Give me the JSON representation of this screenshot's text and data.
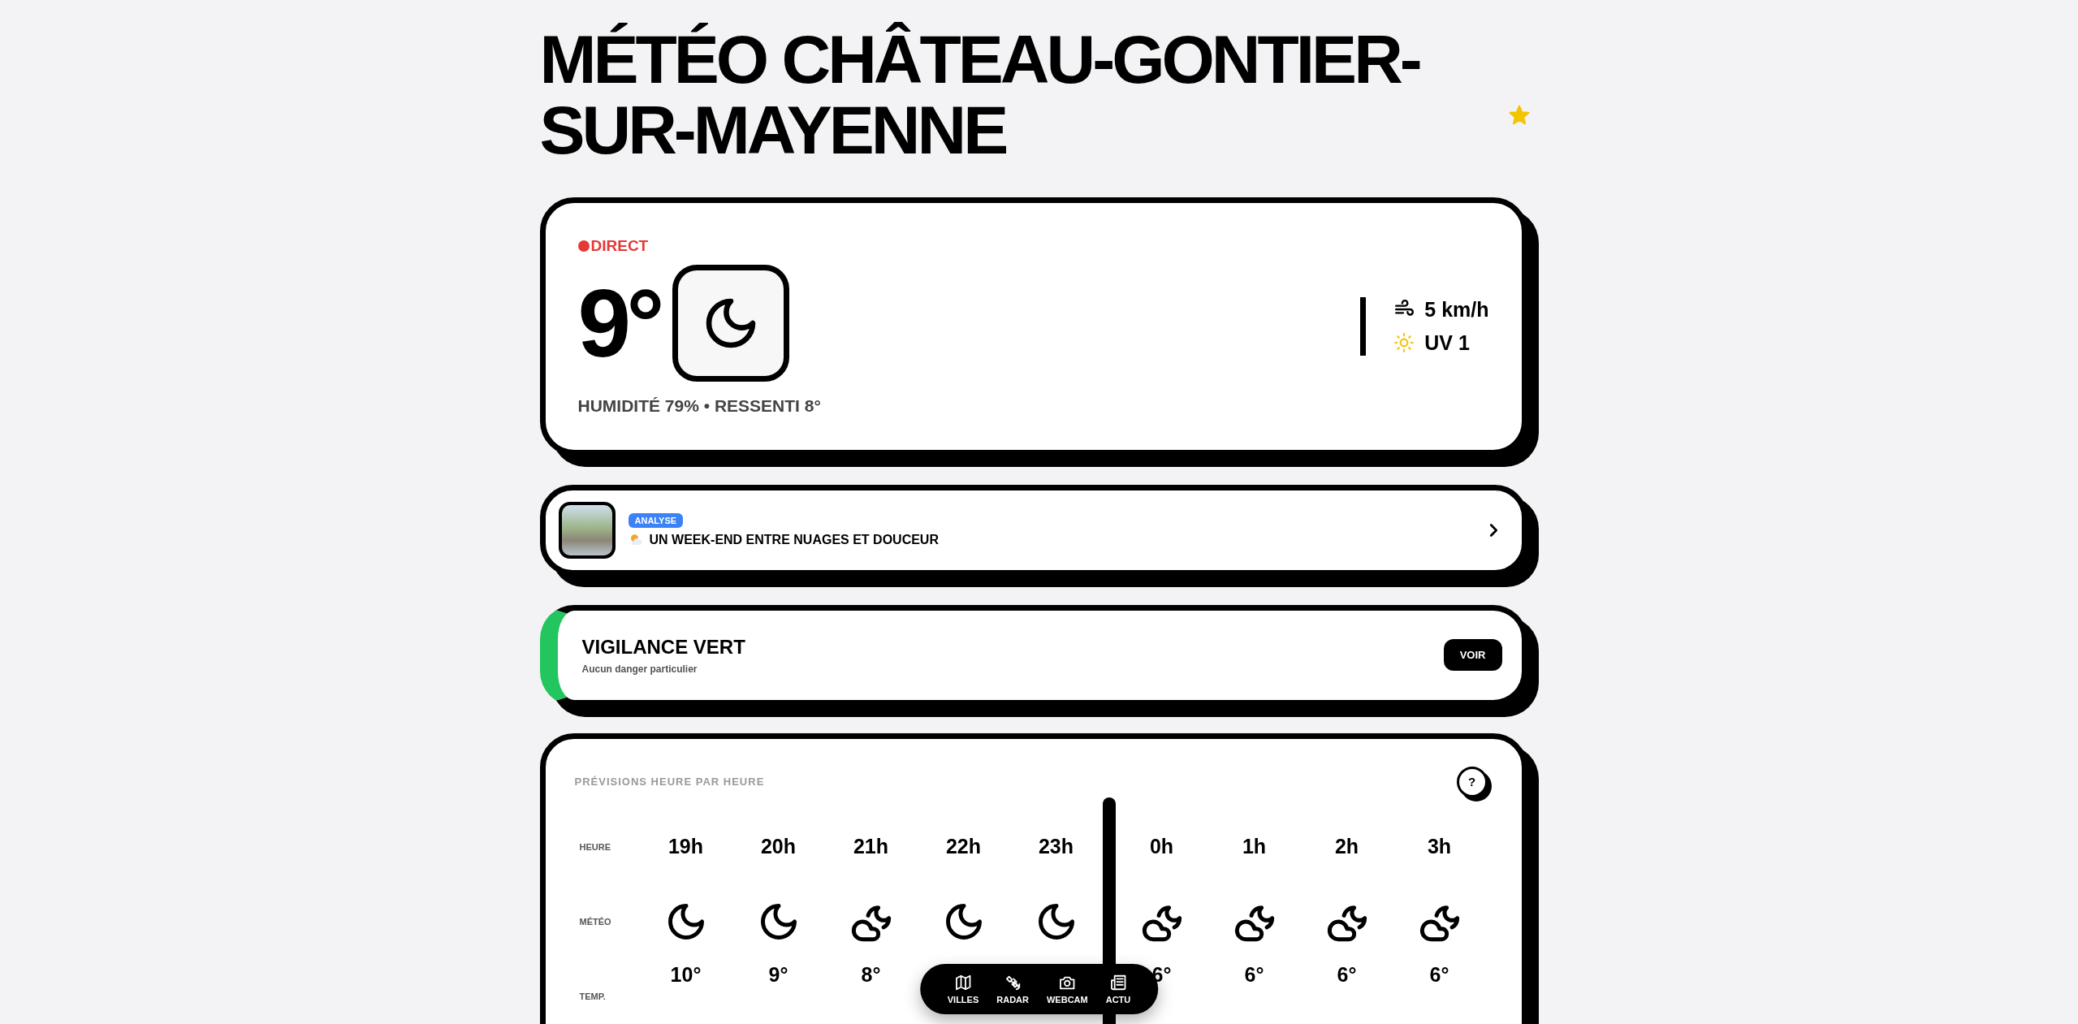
{
  "header": {
    "title": "MÉTÉO CHÂTEAU-GONTIER-SUR-MAYENNE",
    "favorite": true
  },
  "current": {
    "live_label": "DIRECT",
    "temperature": "9°",
    "icon": {
      "kind": "moon"
    },
    "details": "HUMIDITÉ 79% • RESSENTI 8°",
    "wind": "5 km/h",
    "uv": "UV 1"
  },
  "analysis": {
    "badge": "ANALYSE",
    "headline": "UN WEEK-END ENTRE NUAGES ET DOUCEUR"
  },
  "vigilance": {
    "title": "VIGILANCE VERT",
    "subtitle": "Aucun danger particulier",
    "color": "#22c55e",
    "button": "VOIR"
  },
  "hourly": {
    "title": "PRÉVISIONS HEURE PAR HEURE",
    "help": "?",
    "row_labels": [
      "HEURE",
      "MÉTÉO",
      "TEMP."
    ],
    "hours": [
      {
        "time": "19h",
        "kind": "moon",
        "temp": "10°",
        "new_day": false
      },
      {
        "time": "20h",
        "kind": "moon",
        "temp": "9°",
        "new_day": false
      },
      {
        "time": "21h",
        "kind": "cloud-moon",
        "temp": "8°",
        "new_day": false
      },
      {
        "time": "22h",
        "kind": "moon",
        "new_day": false
      },
      {
        "time": "23h",
        "kind": "moon",
        "new_day": false
      },
      {
        "time": "0h",
        "kind": "cloud-moon",
        "temp": "6°",
        "new_day": true
      },
      {
        "time": "1h",
        "kind": "cloud-moon",
        "temp": "6°",
        "new_day": false
      },
      {
        "time": "2h",
        "kind": "cloud-moon",
        "temp": "6°",
        "new_day": false
      },
      {
        "time": "3h",
        "kind": "cloud-moon",
        "temp": "6°",
        "new_day": false
      }
    ]
  },
  "nav": [
    {
      "label": "VILLES",
      "kind": "map"
    },
    {
      "label": "RADAR",
      "kind": "satellite"
    },
    {
      "label": "WEBCAM",
      "kind": "camera"
    },
    {
      "label": "ACTU",
      "kind": "news"
    }
  ]
}
